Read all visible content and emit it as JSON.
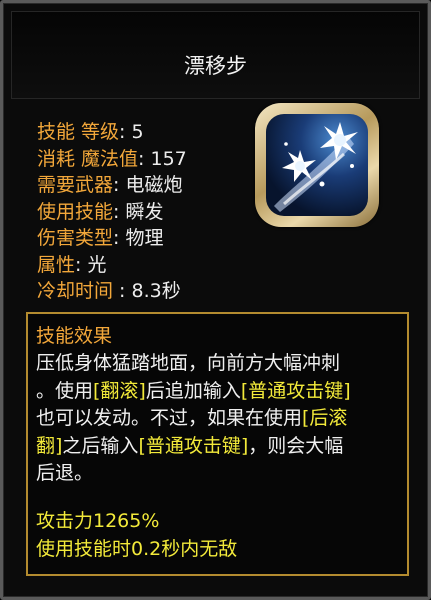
{
  "skill": {
    "name": "漂移步",
    "icon": "blue-spark-dash-icon"
  },
  "stats": [
    {
      "label": "技能 等级",
      "sep": ":",
      "value": " 5"
    },
    {
      "label": "消耗 魔法值",
      "sep": ":",
      "value": " 157"
    },
    {
      "label": "需要武器",
      "sep": ":",
      "value": " 电磁炮"
    },
    {
      "label": "使用技能",
      "sep": ":",
      "value": " 瞬发"
    },
    {
      "label": "伤害类型",
      "sep": ":",
      "value": " 物理"
    },
    {
      "label": "属性",
      "sep": ":",
      "value": " 光"
    },
    {
      "label": "冷却时间 ",
      "sep": ":",
      "value": "  8.3秒"
    }
  ],
  "description": {
    "heading": "技能效果",
    "line1": "压低身体猛踏地面，向前方大幅冲刺",
    "line2_a": "。使用",
    "kw_roll_1": "[翻滚]",
    "line2_b": "后追加输入",
    "kw_attack_1": "[普通攻击键]",
    "line3_a": "也可以发动。不过，如果在使用",
    "kw_roll_2a": "[后滚",
    "kw_roll_2b": "翻]",
    "line4_a": "之后输入",
    "kw_attack_2": "[普通攻击键]",
    "line4_b": "，则会大幅",
    "line5": "后退。",
    "effect1": "攻击力1265%",
    "effect2": "使用技能时0.2秒内无敌"
  },
  "colors": {
    "label_orange": "#f2a73a",
    "keyword_yellow": "#f3ea3a",
    "border_gold": "#b38b2f"
  }
}
